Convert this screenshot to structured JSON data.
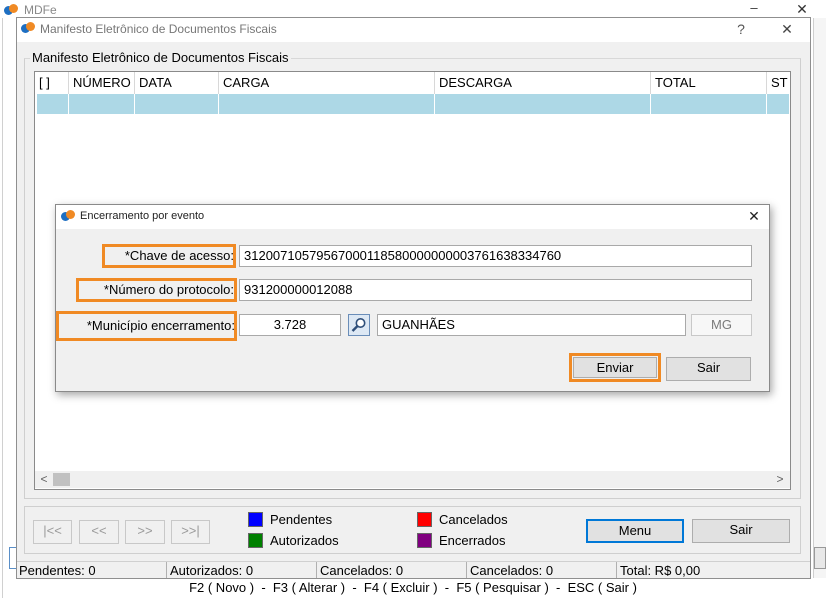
{
  "app": {
    "title": "MDFe"
  },
  "main_window": {
    "title": "Manifesto Eletrônico de Documentos Fiscais",
    "help_label": "?",
    "close_label": "✕",
    "group_title": "Manifesto Eletrônico de Documentos Fiscais",
    "table": {
      "headers": [
        "[ ]",
        "NÚMERO",
        "DATA",
        "CARGA",
        "DESCARGA",
        "TOTAL",
        "ST"
      ]
    },
    "scroll_left": "<",
    "scroll_right": ">",
    "nav": {
      "first": "|<<",
      "prev": "<<",
      "next": ">>",
      "last": ">>|"
    },
    "legend": [
      {
        "label": "Pendentes",
        "color": "#0000ff"
      },
      {
        "label": "Cancelados",
        "color": "#ff0000"
      },
      {
        "label": "Autorizados",
        "color": "#008000"
      },
      {
        "label": "Encerrados",
        "color": "#800080"
      }
    ],
    "menu_button": "Menu",
    "exit_button": "Sair"
  },
  "status_bar": {
    "pendentes": "Pendentes: 0",
    "autorizados": "Autorizados: 0",
    "cancelados1": "Cancelados: 0",
    "cancelados2": "Cancelados: 0",
    "total": "Total: R$ 0,00"
  },
  "shortcuts": "F2 ( Novo )  -  F3 ( Alterar )  -  F4 ( Excluir )  -  F5 ( Pesquisar )  -  ESC ( Sair )",
  "dialog": {
    "title": "Encerramento por evento",
    "close_label": "✕",
    "chave_label": "*Chave de acesso:",
    "chave_value": "31200710579567000118580000000003761638334760",
    "protocolo_label": "*Número do protocolo:",
    "protocolo_value": "931200000012088",
    "municipio_label": "*Município encerramento:",
    "municipio_code": "3.728",
    "municipio_name": "GUANHÃES",
    "uf": "MG",
    "send_button": "Enviar",
    "exit_button": "Sair"
  },
  "colors": {
    "highlight": "#f08a24",
    "selected_row": "#add8e6",
    "accent_button": "#0078d7"
  }
}
